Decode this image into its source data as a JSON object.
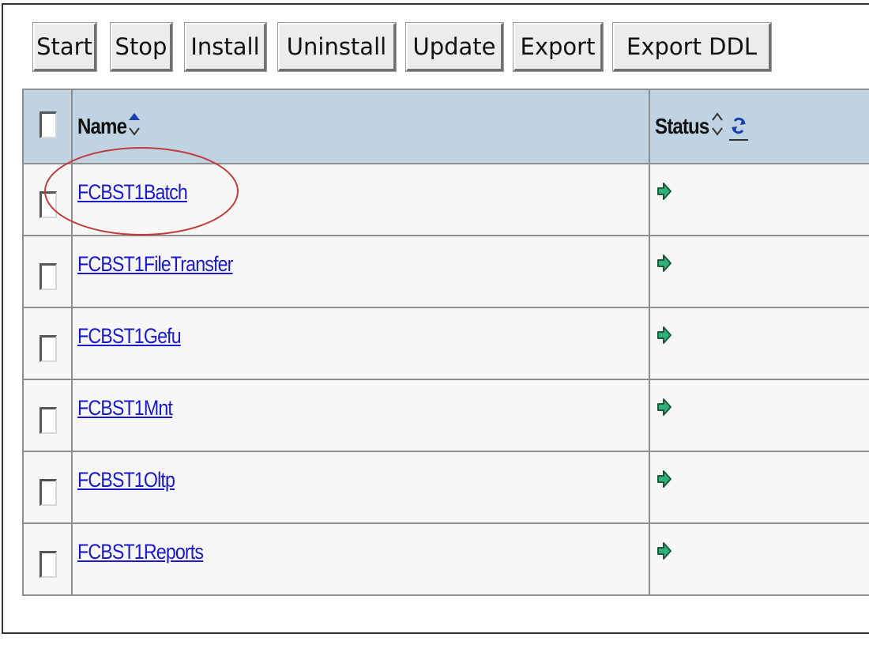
{
  "toolbar": {
    "buttons": [
      "Start",
      "Stop",
      "Install",
      "Uninstall",
      "Update",
      "Export",
      "Export DDL"
    ]
  },
  "table": {
    "headers": {
      "name": "Name",
      "status": "Status"
    },
    "rows": [
      {
        "name": "FCBST1Batch",
        "status_icon": "started-arrow-icon"
      },
      {
        "name": "FCBST1FileTransfer",
        "status_icon": "started-arrow-icon"
      },
      {
        "name": "FCBST1Gefu",
        "status_icon": "started-arrow-icon"
      },
      {
        "name": "FCBST1Mnt",
        "status_icon": "started-arrow-icon"
      },
      {
        "name": "FCBST1Oltp",
        "status_icon": "started-arrow-icon"
      },
      {
        "name": "FCBST1Reports",
        "status_icon": "started-arrow-icon"
      }
    ]
  },
  "colors": {
    "header_bg": "#bfd3e2",
    "link": "#1a1acc",
    "status_green": "#2db07a",
    "annotation_red": "#c23a3a"
  }
}
